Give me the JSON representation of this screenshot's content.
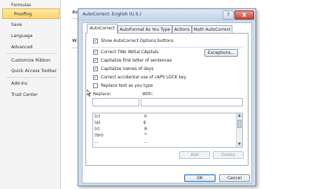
{
  "nav": {
    "items": [
      "Formulas",
      "Proofing",
      "Save",
      "Language",
      "Advanced",
      "Customize Ribbon",
      "Quick Access Toolbar",
      "Add-Ins",
      "Trust Center"
    ],
    "selected_index": 1
  },
  "right_fragments": [
    "Ac",
    "W"
  ],
  "dialog": {
    "title": "AutoCorrect: English (U.S.)",
    "help_glyph": "?",
    "close_glyph": "X",
    "tabs": [
      "AutoCorrect",
      "AutoFormat As You Type",
      "Actions",
      "Math AutoCorrect"
    ],
    "active_tab": 0,
    "show_buttons_label": "Show AutoCorrect Options buttons",
    "show_buttons_checked": true,
    "options": [
      {
        "label": "Correct TWo INitial CApitals",
        "checked": true
      },
      {
        "label": "Capitalize first letter of sentences",
        "checked": true
      },
      {
        "label": "Capitalize names of days",
        "checked": true
      },
      {
        "label": "Correct accidental use of cAPS LOCK key",
        "checked": true
      },
      {
        "label": "Replace text as you type",
        "checked": false
      }
    ],
    "exceptions_label": "Exceptions...",
    "replace_label": "Replace:",
    "with_label": "With:",
    "list_rows": [
      {
        "replace": "(c)",
        "with": "©"
      },
      {
        "replace": "(e)",
        "with": "€"
      },
      {
        "replace": "(r)",
        "with": "®"
      },
      {
        "replace": "(tm)",
        "with": "™"
      },
      {
        "replace": "...",
        "with": "…"
      }
    ],
    "add_label": "Add",
    "delete_label": "Delete",
    "ok_label": "OK",
    "cancel_label": "Cancel"
  },
  "colors": {
    "selected_nav": "#fcd56a",
    "dialog_frame": "#cfdceb",
    "close_button": "#c24735"
  }
}
